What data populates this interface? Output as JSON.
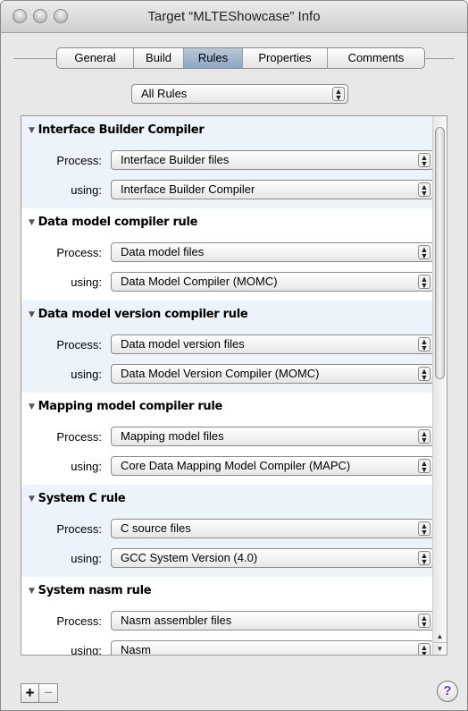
{
  "window": {
    "title": "Target “MLTEShowcase” Info"
  },
  "tabs": [
    "General",
    "Build",
    "Rules",
    "Properties",
    "Comments"
  ],
  "active_tab": "Rules",
  "filter": {
    "selected": "All Rules"
  },
  "labels": {
    "process": "Process:",
    "using": "using:"
  },
  "rules": [
    {
      "title": "Interface Builder Compiler",
      "process": "Interface Builder files",
      "using": "Interface Builder Compiler"
    },
    {
      "title": "Data model compiler rule",
      "process": "Data model files",
      "using": "Data Model Compiler (MOMC)"
    },
    {
      "title": "Data model version compiler rule",
      "process": "Data model version files",
      "using": "Data Model Version Compiler (MOMC)"
    },
    {
      "title": "Mapping model compiler rule",
      "process": "Mapping model files",
      "using": "Core Data Mapping Model Compiler (MAPC)"
    },
    {
      "title": "System C rule",
      "process": "C source files",
      "using": "GCC System Version (4.0)"
    },
    {
      "title": "System nasm rule",
      "process": "Nasm assembler files",
      "using": "Nasm"
    }
  ],
  "buttons": {
    "add": "+",
    "remove": "−",
    "help": "?"
  },
  "icons": {
    "disclosure": "▼",
    "popup_arrows": "▲▼",
    "scroll_up": "▲",
    "scroll_down": "▼"
  }
}
